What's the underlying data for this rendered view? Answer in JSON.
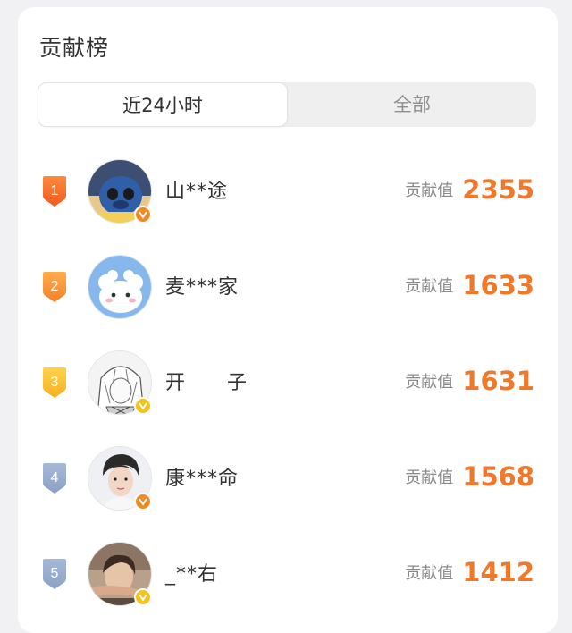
{
  "header": {
    "title": "贡献榜"
  },
  "tabs": [
    {
      "label": "近24小时",
      "active": true
    },
    {
      "label": "全部",
      "active": false
    }
  ],
  "score_label": "贡献值",
  "accent_color": "#f0782a",
  "rows": [
    {
      "rank": "1",
      "name": "山**途",
      "score": "2355",
      "verified": true
    },
    {
      "rank": "2",
      "name": "麦***家",
      "score": "1633",
      "verified": false
    },
    {
      "rank": "3",
      "name": "开　　子",
      "score": "1631",
      "verified": true
    },
    {
      "rank": "4",
      "name": "康***命",
      "score": "1568",
      "verified": true
    },
    {
      "rank": "5",
      "name": "_**右",
      "score": "1412",
      "verified": true
    }
  ]
}
